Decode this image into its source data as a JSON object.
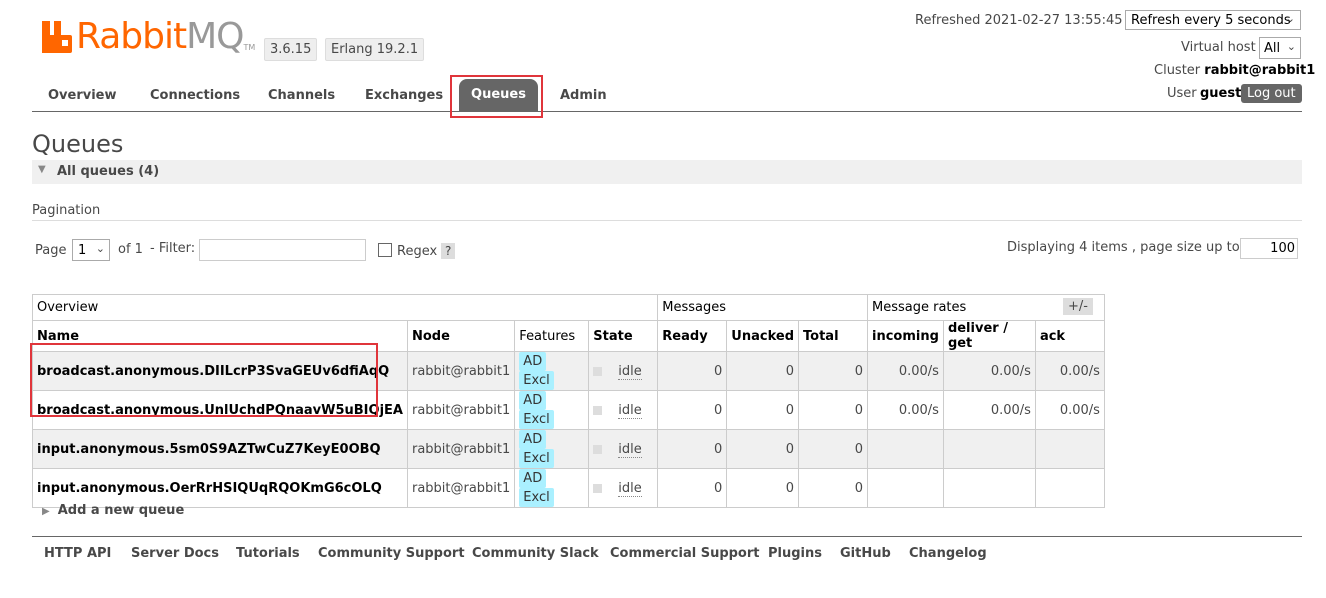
{
  "brand": {
    "name_main": "Rabbit",
    "name_suffix": "MQ",
    "tm": "TM",
    "version": "3.6.15",
    "erlang": "Erlang 19.2.1"
  },
  "header": {
    "refreshed": "Refreshed 2021-02-27 13:55:45",
    "refresh_option": "Refresh every 5 seconds",
    "vhost_label": "Virtual host",
    "vhost_value": "All",
    "cluster_label": "Cluster",
    "cluster_value": "rabbit@rabbit1",
    "user_label": "User",
    "user_value": "guest",
    "logout": "Log out"
  },
  "nav": {
    "overview": "Overview",
    "connections": "Connections",
    "channels": "Channels",
    "exchanges": "Exchanges",
    "queues": "Queues",
    "admin": "Admin"
  },
  "page": {
    "title": "Queues",
    "section": "All queues (4)"
  },
  "pagination": {
    "title": "Pagination",
    "page_label": "Page",
    "page_value": "1",
    "of": "of 1",
    "filter_label": "- Filter:",
    "regex": "Regex",
    "help": "?",
    "displaying": "Displaying 4 items , page size up to:",
    "page_size": "100"
  },
  "table": {
    "group_overview": "Overview",
    "group_messages": "Messages",
    "group_rates": "Message rates",
    "plusminus": "+/-",
    "headers": {
      "name": "Name",
      "node": "Node",
      "features": "Features",
      "state": "State",
      "ready": "Ready",
      "unacked": "Unacked",
      "total": "Total",
      "incoming": "incoming",
      "deliver": "deliver / get",
      "ack": "ack"
    },
    "rows": [
      {
        "name": "broadcast.anonymous.DIILcrP3SvaGEUv6dfiAqQ",
        "node": "rabbit@rabbit1",
        "f1": "AD",
        "f2": "Excl",
        "state": "idle",
        "ready": "0",
        "unacked": "0",
        "total": "0",
        "incoming": "0.00/s",
        "deliver": "0.00/s",
        "ack": "0.00/s"
      },
      {
        "name": "broadcast.anonymous.UnlUchdPQnaavW5uBIQjEA",
        "node": "rabbit@rabbit1",
        "f1": "AD",
        "f2": "Excl",
        "state": "idle",
        "ready": "0",
        "unacked": "0",
        "total": "0",
        "incoming": "0.00/s",
        "deliver": "0.00/s",
        "ack": "0.00/s"
      },
      {
        "name": "input.anonymous.5sm0S9AZTwCuZ7KeyE0OBQ",
        "node": "rabbit@rabbit1",
        "f1": "AD",
        "f2": "Excl",
        "state": "idle",
        "ready": "0",
        "unacked": "0",
        "total": "0",
        "incoming": "",
        "deliver": "",
        "ack": ""
      },
      {
        "name": "input.anonymous.OerRrHSIQUqRQOKmG6cOLQ",
        "node": "rabbit@rabbit1",
        "f1": "AD",
        "f2": "Excl",
        "state": "idle",
        "ready": "0",
        "unacked": "0",
        "total": "0",
        "incoming": "",
        "deliver": "",
        "ack": ""
      }
    ]
  },
  "add_queue": "Add a new queue",
  "footer": {
    "http_api": "HTTP API",
    "server_docs": "Server Docs",
    "tutorials": "Tutorials",
    "community_support": "Community Support",
    "community_slack": "Community Slack",
    "commercial_support": "Commercial Support",
    "plugins": "Plugins",
    "github": "GitHub",
    "changelog": "Changelog"
  },
  "colors": {
    "brand": "#ff6600",
    "accent_nav": "#666666",
    "annotation": "#e0353b",
    "badge": "#aaf0ff"
  }
}
